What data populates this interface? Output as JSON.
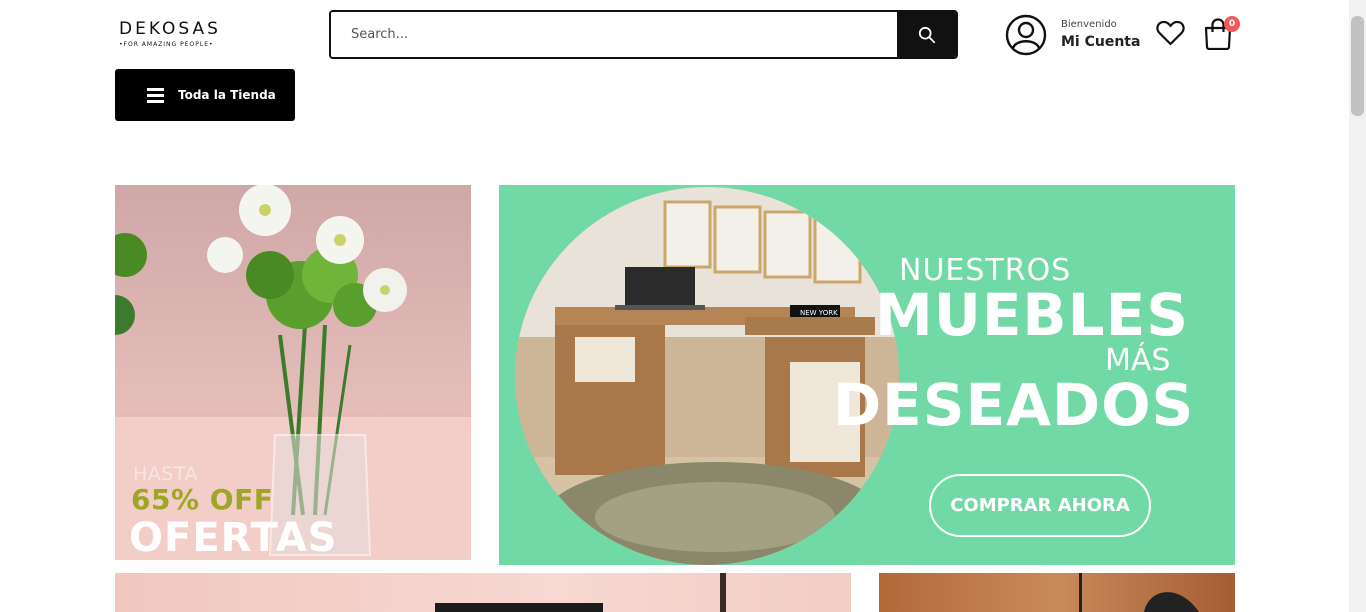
{
  "header": {
    "logo_name": "DEKOSAS",
    "logo_tagline": "•FOR AMAZING PEOPLE•",
    "search_placeholder": "Search...",
    "account_greeting": "Bienvenido",
    "account_title": "Mi Cuenta",
    "cart_count": "0"
  },
  "nav": {
    "menu_label": "Toda la Tienda"
  },
  "banners": {
    "left": {
      "line1": "HASTA",
      "line2": "65% OFF",
      "line3": "OFERTAS"
    },
    "right": {
      "line1": "NUESTROS",
      "line2": "MUEBLES",
      "line3": "MÁS",
      "line4": "DESEADOS",
      "book_label": "NEW YORK",
      "cta_label": "COMPRAR AHORA"
    }
  },
  "colors": {
    "accent_green": "#70d9a5",
    "badge": "#f05a5a",
    "promo_olive": "#9ea625"
  },
  "icons": {
    "search": "search-icon",
    "account": "user-circle-icon",
    "wishlist": "heart-icon",
    "cart": "shopping-bag-icon",
    "menu": "hamburger-icon"
  }
}
